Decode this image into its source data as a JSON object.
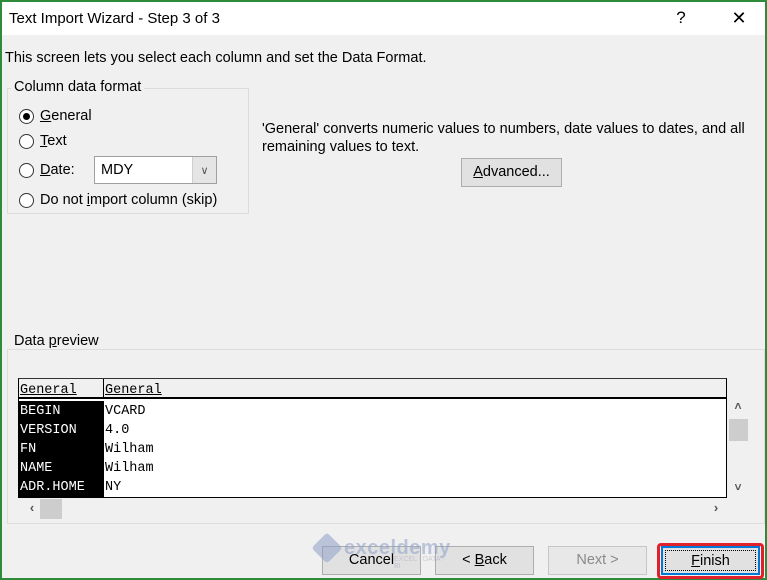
{
  "window": {
    "title": "Text Import Wizard - Step 3 of 3",
    "help_label": "?",
    "close_label": "✕"
  },
  "intro_text": "This screen lets you select each column and set the Data Format.",
  "column_format": {
    "group_label": "Column data format",
    "options": [
      {
        "pre": "",
        "accel": "G",
        "post": "eneral",
        "checked": true
      },
      {
        "pre": "",
        "accel": "T",
        "post": "ext",
        "checked": false
      },
      {
        "pre": "",
        "accel": "D",
        "post": "ate:",
        "checked": false
      },
      {
        "pre": "Do not ",
        "accel": "i",
        "post": "mport column (skip)",
        "checked": false
      }
    ],
    "date_select": {
      "value": "MDY",
      "arrow_icon": "∨"
    }
  },
  "description": "'General' converts numeric values to numbers, date values to dates, and all remaining values to text.",
  "advanced_button": {
    "accel": "A",
    "rest": "dvanced..."
  },
  "data_preview": {
    "group_label_pre": "Data ",
    "group_label_accel": "p",
    "group_label_post": "review",
    "headers": [
      "General",
      "General"
    ],
    "rows": [
      [
        "BEGIN",
        "VCARD"
      ],
      [
        "VERSION",
        "4.0"
      ],
      [
        "FN",
        "Wilham"
      ],
      [
        "NAME",
        "Wilham"
      ],
      [
        "ADR.HOME",
        "NY"
      ]
    ],
    "scroll_up": "˄",
    "scroll_down": "˅",
    "scroll_left": "‹",
    "scroll_right": "›"
  },
  "buttons": {
    "cancel": "Cancel",
    "back_pre": "< ",
    "back_accel": "B",
    "back_post": "ack",
    "next": "Next >",
    "finish_accel": "F",
    "finish_post": "inish"
  },
  "watermark": {
    "name": "exceldemy",
    "sub": "EXCEL · DATA · BI"
  }
}
